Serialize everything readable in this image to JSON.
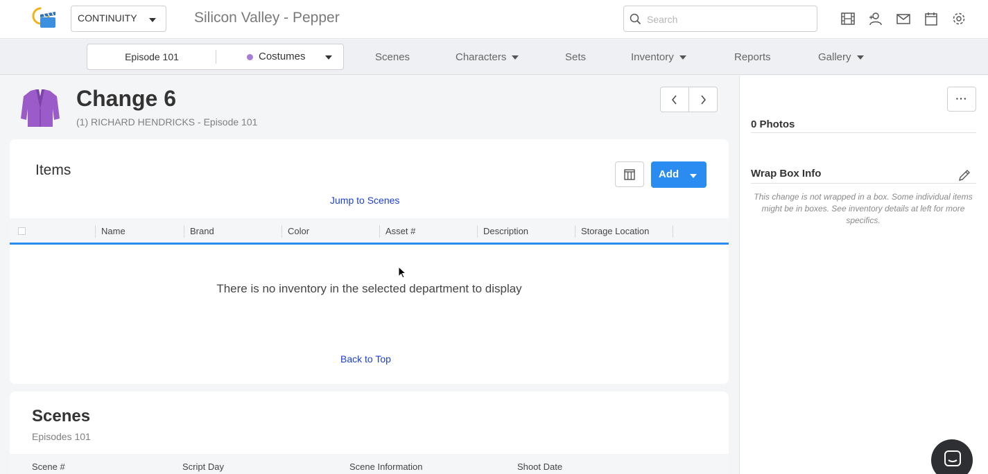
{
  "header": {
    "mode_select": "CONTINUITY",
    "project_title": "Silicon Valley - Pepper",
    "search_placeholder": "Search",
    "icons": [
      "film-icon",
      "person-add-icon",
      "mail-icon",
      "calendar-icon",
      "gear-icon"
    ]
  },
  "nav": {
    "episode": "Episode 101",
    "department": "Costumes",
    "department_color": "#a67cd6",
    "items": [
      {
        "label": "Scenes",
        "dropdown": false
      },
      {
        "label": "Characters",
        "dropdown": true
      },
      {
        "label": "Sets",
        "dropdown": false
      },
      {
        "label": "Inventory",
        "dropdown": true
      },
      {
        "label": "Reports",
        "dropdown": false
      },
      {
        "label": "Gallery",
        "dropdown": true
      }
    ]
  },
  "change": {
    "title": "Change 6",
    "subtitle": "(1) RICHARD HENDRICKS - Episode 101"
  },
  "items": {
    "title": "Items",
    "add_label": "Add",
    "jump_link": "Jump to Scenes",
    "columns": [
      "Name",
      "Brand",
      "Color",
      "Asset #",
      "Description",
      "Storage Location"
    ],
    "empty_message": "There is no inventory in the selected department to display",
    "back_to_top": "Back to Top"
  },
  "scenes": {
    "title": "Scenes",
    "subtitle": "Episodes 101",
    "columns": [
      "Scene #",
      "Script Day",
      "Scene Information",
      "Shoot Date"
    ]
  },
  "right_panel": {
    "more_label": "···",
    "photos_label": "0 Photos",
    "wrap_title": "Wrap Box Info",
    "wrap_note": "This change is not wrapped in a box. Some individual items might be in boxes. See inventory details at left for more specifics."
  },
  "colors": {
    "accent": "#2a8cf0",
    "link": "#1c3fd4",
    "jacket": "#9b5bc8"
  }
}
